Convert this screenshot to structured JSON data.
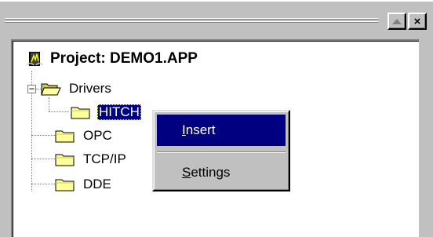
{
  "window": {
    "maximize_icon": "maximize-triangle-icon",
    "close_glyph": "×"
  },
  "tree": {
    "project": {
      "icon": "project-book-icon",
      "label": "Project: DEMO1.APP"
    },
    "drivers": {
      "icon": "folder-open-icon",
      "label": "Drivers",
      "expander": "−"
    },
    "hitch": {
      "icon": "folder-icon",
      "label": "HITCH",
      "selected": true
    },
    "opc": {
      "icon": "folder-icon",
      "label": "OPC"
    },
    "tcpip": {
      "icon": "folder-icon",
      "label": "TCP/IP"
    },
    "dde": {
      "icon": "folder-icon",
      "label": "DDE"
    }
  },
  "context_menu": {
    "insert": {
      "mnemonic": "I",
      "rest": "nsert",
      "highlighted": true
    },
    "settings": {
      "mnemonic": "S",
      "rest": "ettings"
    }
  }
}
